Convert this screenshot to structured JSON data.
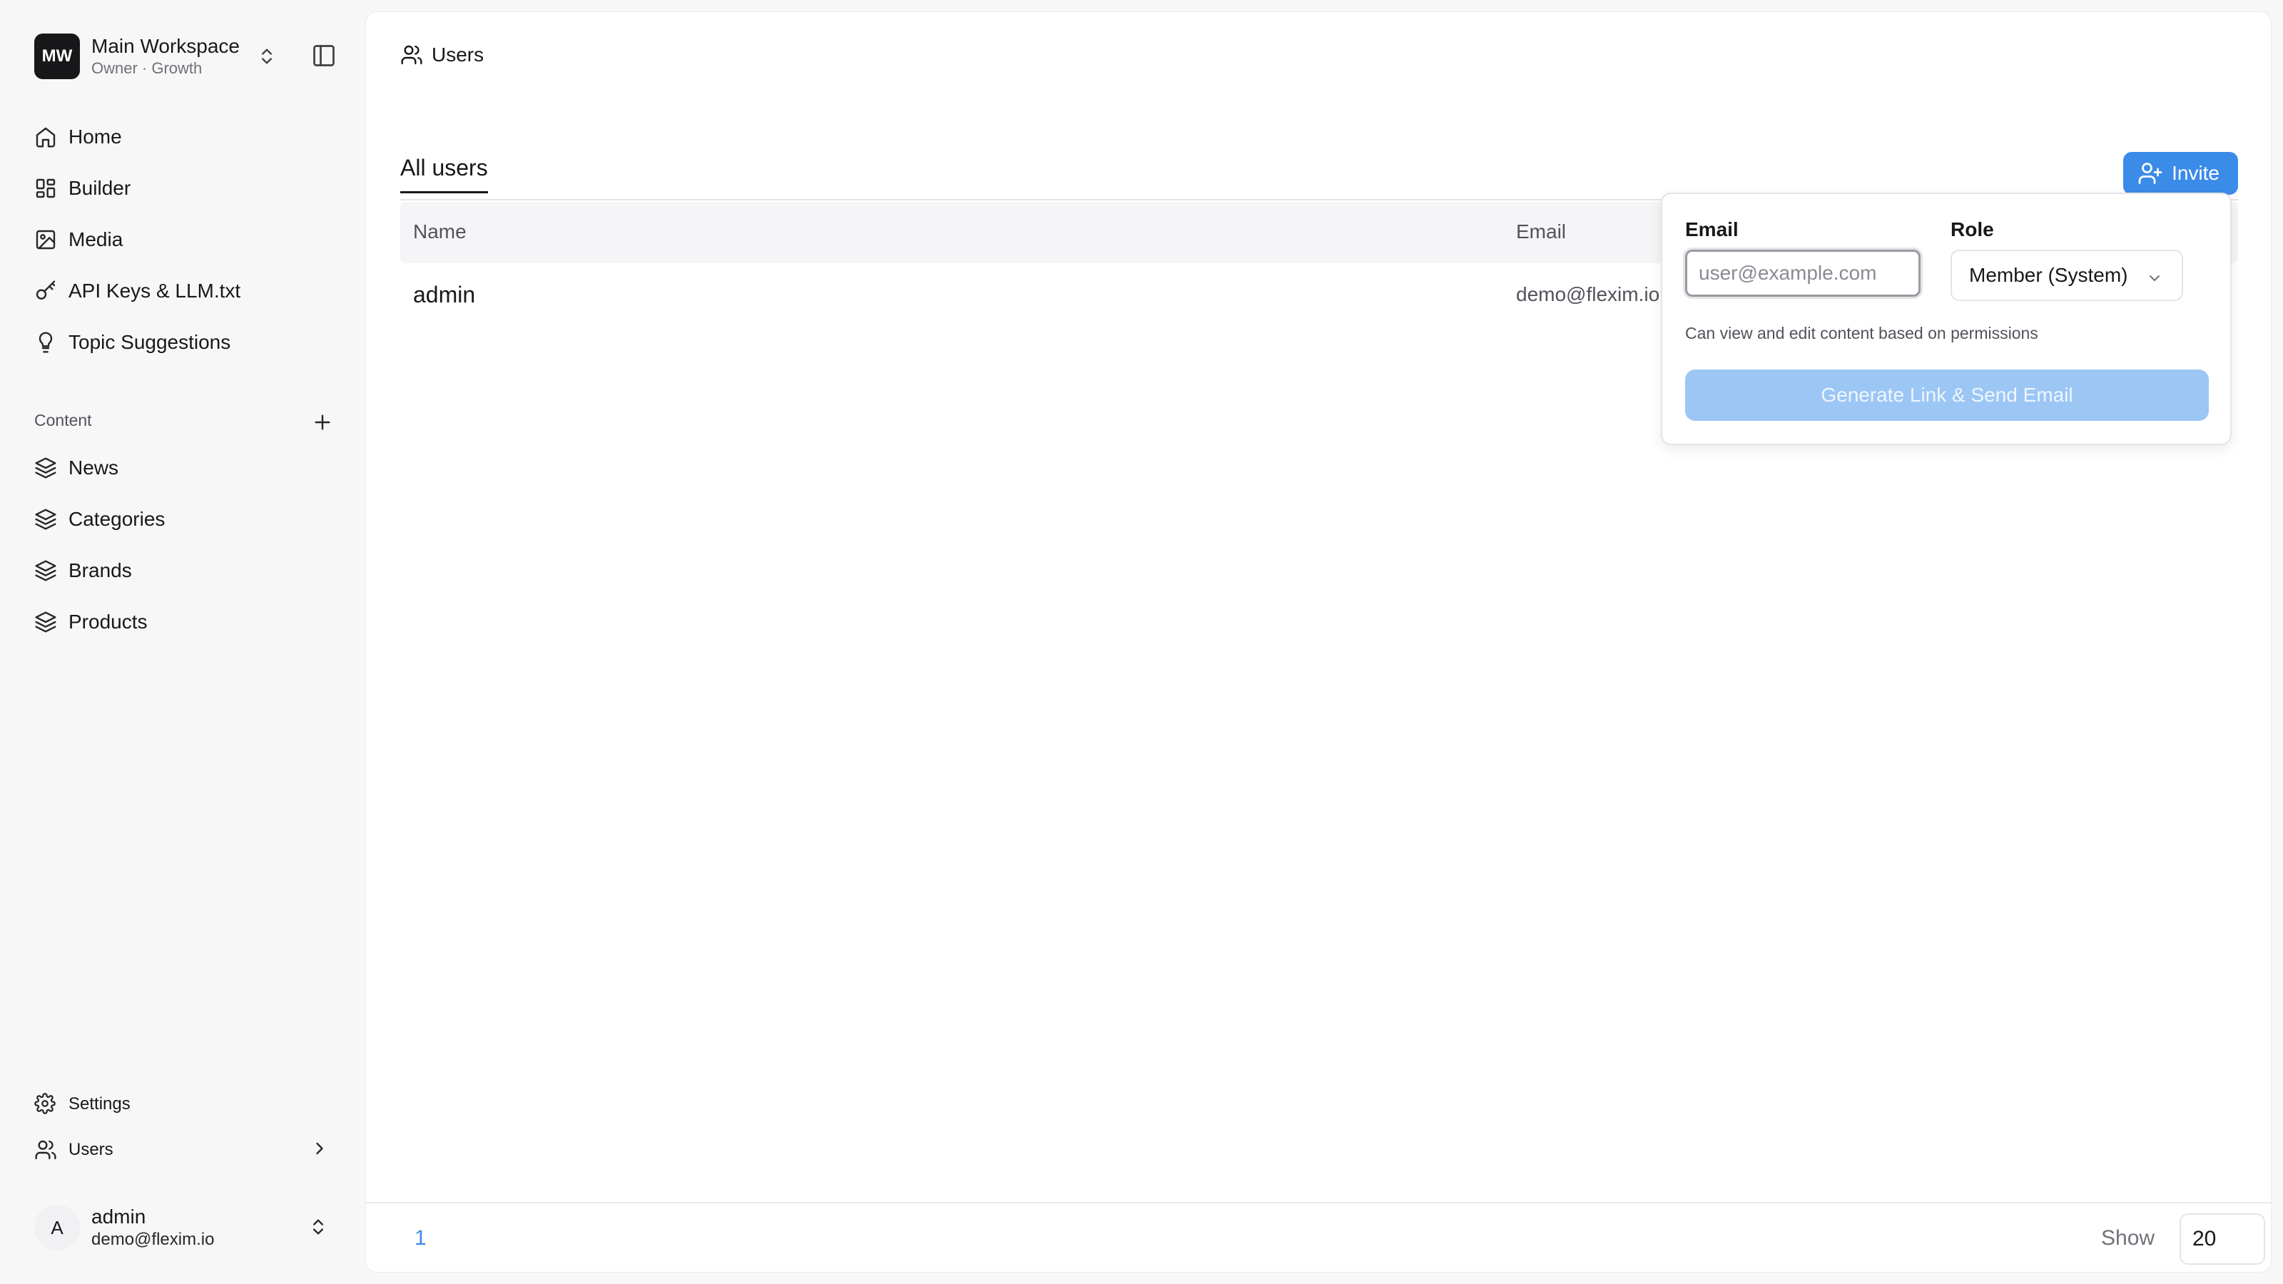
{
  "workspace": {
    "logo_initials": "MW",
    "name": "Main Workspace",
    "subtitle": "Owner · Growth"
  },
  "sidebar": {
    "nav": [
      {
        "label": "Home",
        "icon": "home-icon"
      },
      {
        "label": "Builder",
        "icon": "grid-icon"
      },
      {
        "label": "Media",
        "icon": "image-icon"
      },
      {
        "label": "API Keys & LLM.txt",
        "icon": "key-icon"
      },
      {
        "label": "Topic Suggestions",
        "icon": "lightbulb-icon"
      }
    ],
    "content_section_label": "Content",
    "content_items": [
      {
        "label": "News",
        "icon": "layers-icon"
      },
      {
        "label": "Categories",
        "icon": "layers-icon"
      },
      {
        "label": "Brands",
        "icon": "layers-icon"
      },
      {
        "label": "Products",
        "icon": "layers-icon"
      }
    ],
    "bottom_items": [
      {
        "label": "Settings",
        "icon": "gear-icon"
      },
      {
        "label": "Users",
        "icon": "users-icon"
      }
    ]
  },
  "current_user": {
    "avatar_initial": "A",
    "name": "admin",
    "email": "demo@flexim.io"
  },
  "main": {
    "breadcrumb": "Users",
    "tab_label": "All users",
    "invite_label": "Invite",
    "table": {
      "headers": [
        "Name",
        "Email"
      ],
      "rows": [
        {
          "name": "admin",
          "email": "demo@flexim.io"
        }
      ]
    },
    "pagination": {
      "current_page": "1",
      "show_label": "Show",
      "page_size": "20"
    }
  },
  "invite_popover": {
    "email_label": "Email",
    "email_placeholder": "user@example.com",
    "email_value": "",
    "role_label": "Role",
    "role_value": "Member (System)",
    "role_description": "Can view and edit content based on permissions",
    "submit_label": "Generate Link & Send Email"
  },
  "colors": {
    "accent": "#3b8be8",
    "accent_disabled": "#9cc6f4",
    "sidebar_bg": "#f7f7f8",
    "text": "#18181b"
  }
}
